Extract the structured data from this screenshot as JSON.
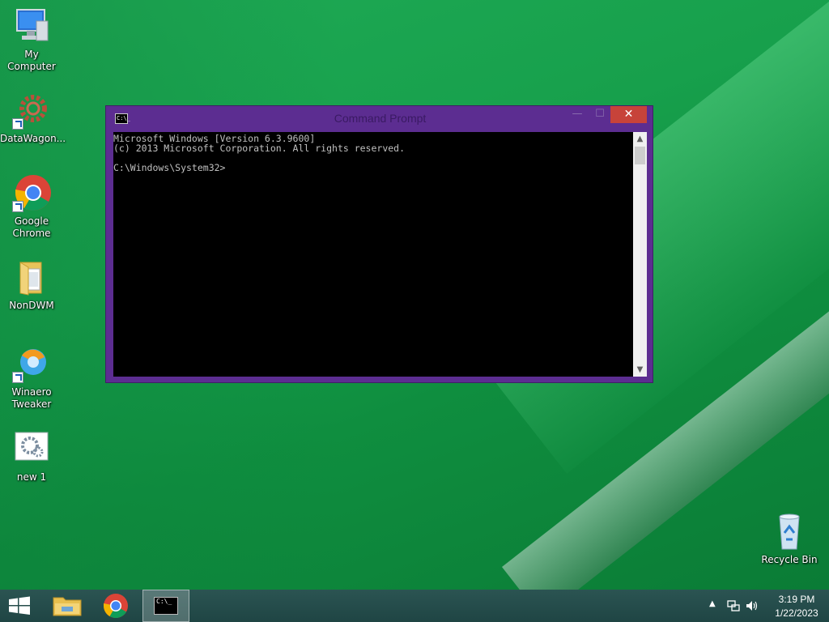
{
  "desktop": {
    "icons": [
      {
        "label": "My Computer"
      },
      {
        "label": "DataWagon..."
      },
      {
        "label": "Google Chrome"
      },
      {
        "label": "NonDWM"
      },
      {
        "label": "Winaero Tweaker"
      },
      {
        "label": "new 1"
      },
      {
        "label": "Recycle Bin"
      }
    ]
  },
  "window": {
    "title": "Command Prompt",
    "icon_text": "C:\\_",
    "buttons": {
      "minimize": "—",
      "maximize": "☐",
      "close": "✕"
    },
    "console": {
      "line1": "Microsoft Windows [Version 6.3.9600]",
      "line2": "(c) 2013 Microsoft Corporation. All rights reserved.",
      "line3": "",
      "line4": "C:\\Windows\\System32>"
    }
  },
  "taskbar": {
    "tray_time": "3:19 PM",
    "tray_date": "1/22/2023",
    "cmd_icon_text": "C:\\_"
  }
}
